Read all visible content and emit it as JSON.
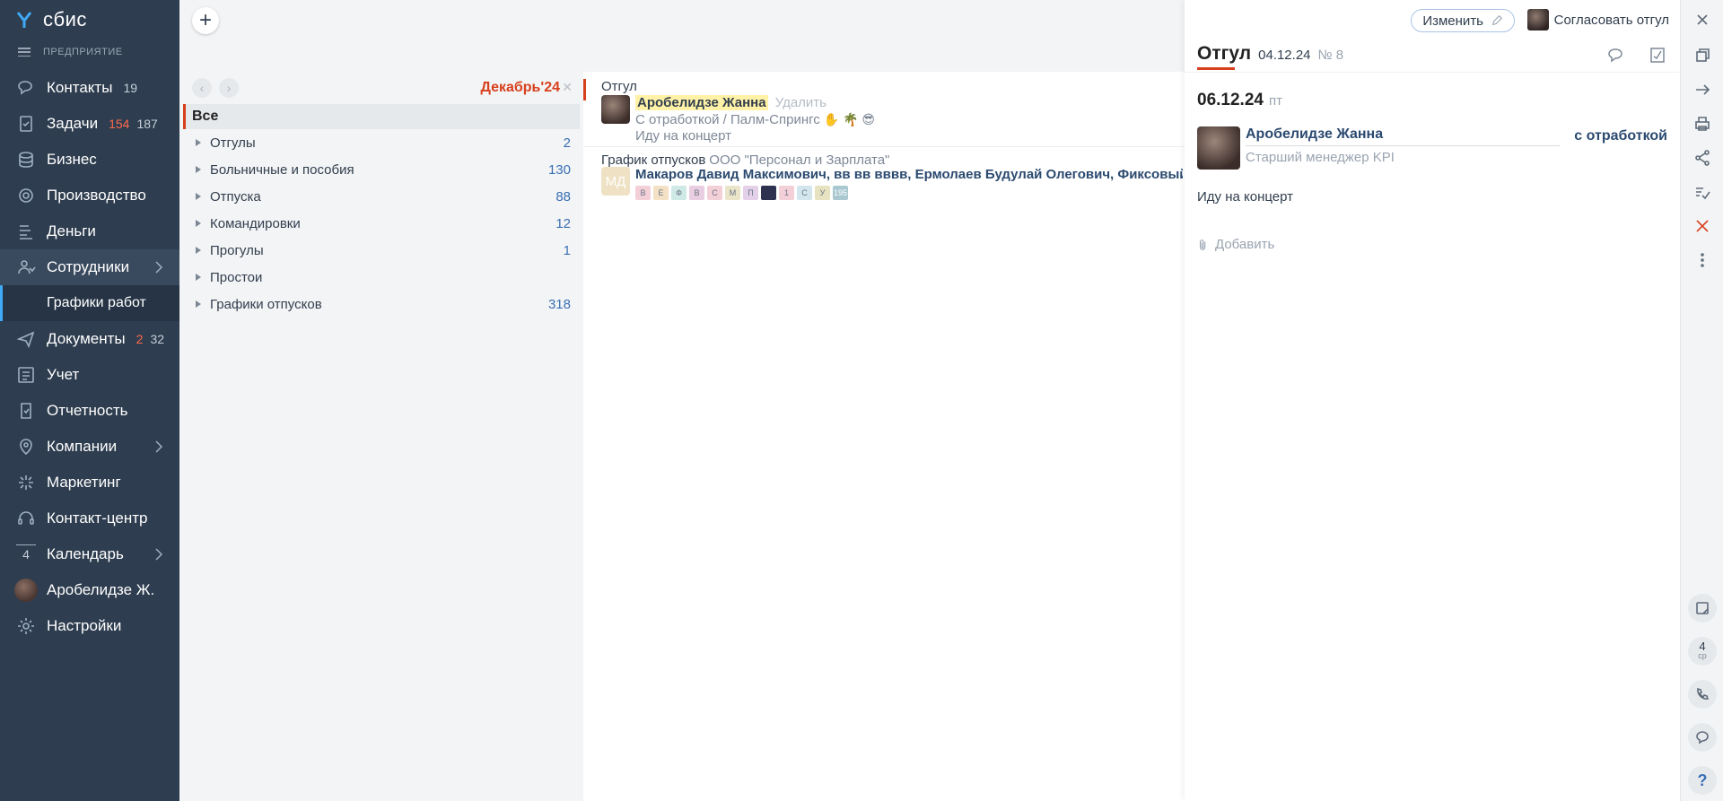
{
  "sidebar": {
    "logo": "сбис",
    "org": "ПРЕДПРИЯТИЕ",
    "items": [
      {
        "label": "Контакты",
        "count": "19",
        "icon": "chat-bubbles-icon"
      },
      {
        "label": "Задачи",
        "count_red": "154",
        "count": "187",
        "icon": "tasks-icon"
      },
      {
        "label": "Бизнес",
        "icon": "business-stack-icon"
      },
      {
        "label": "Производство",
        "icon": "production-gear-icon"
      },
      {
        "label": "Деньги",
        "icon": "money-icon"
      },
      {
        "label": "Сотрудники",
        "icon": "employees-icon",
        "sub": "Графики работ"
      },
      {
        "label": "Документы",
        "count_red": "2",
        "count": "32",
        "icon": "paper-plane-icon"
      },
      {
        "label": "Учет",
        "icon": "accounting-icon"
      },
      {
        "label": "Отчетность",
        "icon": "reports-icon"
      },
      {
        "label": "Компании",
        "icon": "companies-icon"
      },
      {
        "label": "Маркетинг",
        "icon": "marketing-icon"
      },
      {
        "label": "Контакт-центр",
        "icon": "headset-icon"
      },
      {
        "label": "Календарь",
        "icon": "calendar-icon",
        "day": "4"
      },
      {
        "label": "Аробелидзе Ж.",
        "icon": "user-avatar"
      },
      {
        "label": "Настройки",
        "icon": "settings-gear-icon"
      }
    ]
  },
  "filters": {
    "period": "Декабрь'24",
    "all": "Все",
    "items": [
      {
        "label": "Отгулы",
        "count": "2"
      },
      {
        "label": "Больничные и пособия",
        "count": "130"
      },
      {
        "label": "Отпуска",
        "count": "88"
      },
      {
        "label": "Командировки",
        "count": "12"
      },
      {
        "label": "Прогулы",
        "count": "1"
      },
      {
        "label": "Простои",
        "count": ""
      },
      {
        "label": "Графики отпусков",
        "count": "318"
      }
    ]
  },
  "list": {
    "row1": {
      "title": "Отгул",
      "name": "Аробелидзе Жанна",
      "delete": "Удалить",
      "sub": "С отработкой / Палм-Спрингс",
      "emojis": "✋ 🌴 😎",
      "comment": "Иду на концерт"
    },
    "row2": {
      "title": "График отпусков",
      "org": "ООО \"Персонал и Зарплата\"",
      "initials": "МД",
      "names": "Макаров Давид Максимович, вв вв вввв, Ермолаев Будулай Олегович, Фиксовый",
      "chips": [
        "В",
        "Е",
        "Ф",
        "В",
        "С",
        "М",
        "П",
        "",
        "1",
        "С",
        "У",
        "195"
      ]
    }
  },
  "panel": {
    "edit": "Изменить",
    "approve": "Согласовать отгул",
    "title": "Отгул",
    "date": "04.12.24",
    "number": "№ 8",
    "day": "06.12.24",
    "dow": "пт",
    "person": "Аробелидзе Жанна",
    "role": "Старший менеджер KPI",
    "type": "с отработкой",
    "comment": "Иду на концерт",
    "add": "Добавить"
  },
  "toolbar": {
    "calendar_day": "4",
    "calendar_dow": "ср",
    "help": "?"
  },
  "colors": {
    "sidebar": "#2e3d4f",
    "accent": "#d7401e",
    "link": "#2b4a70",
    "count": "#3a6fb4"
  }
}
